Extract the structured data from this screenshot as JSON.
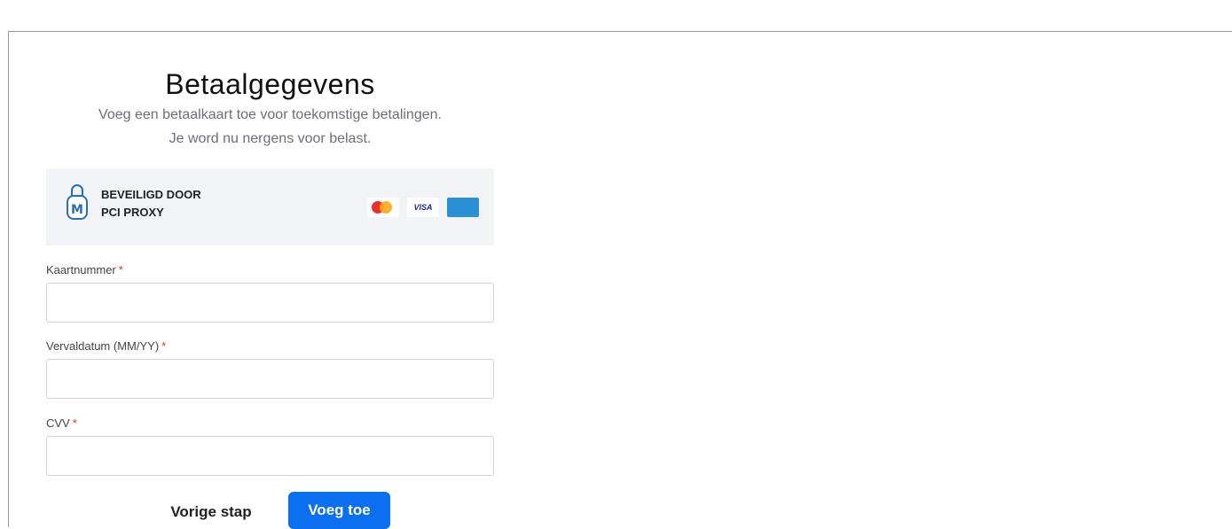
{
  "form": {
    "title": "Betaalgegevens",
    "subtitle_line1": "Voeg een betaalkaart toe voor toekomstige betalingen.",
    "subtitle_line2": "Je word nu nergens voor belast."
  },
  "security": {
    "line1": "BEVEILIGD DOOR",
    "line2": "PCI PROXY",
    "lock_letter": "M",
    "cards": [
      {
        "name": "mastercard-icon"
      },
      {
        "name": "visa-icon",
        "text": "VISA"
      },
      {
        "name": "amex-icon"
      }
    ]
  },
  "fields": {
    "card_number": {
      "label": "Kaartnummer",
      "required_mark": "*",
      "value": ""
    },
    "expiry": {
      "label": "Vervaldatum (MM/YY)",
      "required_mark": "*",
      "value": ""
    },
    "cvv": {
      "label": "CVV",
      "required_mark": "*",
      "value": ""
    }
  },
  "actions": {
    "back_label": "Vorige stap",
    "submit_label": "Voeg toe"
  },
  "colors": {
    "primary": "#0b6ff0",
    "required": "#d9342b",
    "secure_bg": "#f1f3f6"
  }
}
